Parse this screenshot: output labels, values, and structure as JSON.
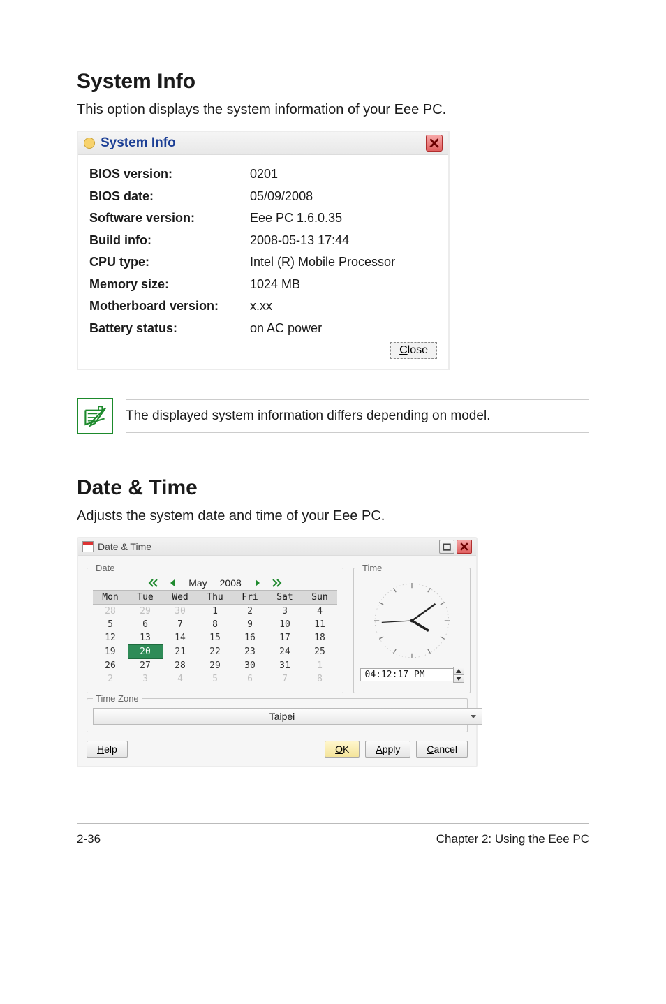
{
  "section1": {
    "title": "System Info",
    "description": "This option displays the system information of your Eee PC."
  },
  "sysinfo_window": {
    "title": "System Info",
    "rows": [
      {
        "label": "BIOS version:",
        "value": "0201"
      },
      {
        "label": "BIOS date:",
        "value": "05/09/2008"
      },
      {
        "label": "Software version:",
        "value": "Eee PC 1.6.0.35"
      },
      {
        "label": "Build info:",
        "value": "2008-05-13 17:44"
      },
      {
        "label": "CPU type:",
        "value": "Intel (R) Mobile Processor"
      },
      {
        "label": "Memory size:",
        "value": "1024 MB"
      },
      {
        "label": "Motherboard version:",
        "value": "x.xx"
      },
      {
        "label": "Battery status:",
        "value": "on AC power"
      }
    ],
    "close_label": "Close"
  },
  "note": {
    "text": "The displayed system information differs depending on model."
  },
  "section2": {
    "title": "Date & Time",
    "description": "Adjusts the system date and time of your Eee PC."
  },
  "datetime_window": {
    "title": "Date & Time",
    "date_legend": "Date",
    "time_legend": "Time",
    "timezone_legend": "Time Zone",
    "month": "May",
    "year": "2008",
    "day_headers": [
      "Mon",
      "Tue",
      "Wed",
      "Thu",
      "Fri",
      "Sat",
      "Sun"
    ],
    "weeks": [
      [
        {
          "d": "28",
          "dim": true
        },
        {
          "d": "29",
          "dim": true
        },
        {
          "d": "30",
          "dim": true
        },
        {
          "d": "1"
        },
        {
          "d": "2"
        },
        {
          "d": "3"
        },
        {
          "d": "4"
        }
      ],
      [
        {
          "d": "5"
        },
        {
          "d": "6"
        },
        {
          "d": "7"
        },
        {
          "d": "8"
        },
        {
          "d": "9"
        },
        {
          "d": "10"
        },
        {
          "d": "11"
        }
      ],
      [
        {
          "d": "12"
        },
        {
          "d": "13"
        },
        {
          "d": "14"
        },
        {
          "d": "15"
        },
        {
          "d": "16"
        },
        {
          "d": "17"
        },
        {
          "d": "18"
        }
      ],
      [
        {
          "d": "19"
        },
        {
          "d": "20",
          "today": true
        },
        {
          "d": "21"
        },
        {
          "d": "22"
        },
        {
          "d": "23"
        },
        {
          "d": "24"
        },
        {
          "d": "25"
        }
      ],
      [
        {
          "d": "26"
        },
        {
          "d": "27"
        },
        {
          "d": "28"
        },
        {
          "d": "29"
        },
        {
          "d": "30"
        },
        {
          "d": "31"
        },
        {
          "d": "1",
          "dim": true
        }
      ],
      [
        {
          "d": "2",
          "dim": true
        },
        {
          "d": "3",
          "dim": true
        },
        {
          "d": "4",
          "dim": true
        },
        {
          "d": "5",
          "dim": true
        },
        {
          "d": "6",
          "dim": true
        },
        {
          "d": "7",
          "dim": true
        },
        {
          "d": "8",
          "dim": true
        }
      ]
    ],
    "time_value": "04:12:17 PM",
    "timezone_value": "Taipei",
    "buttons": {
      "help": "Help",
      "ok": "OK",
      "apply": "Apply",
      "cancel": "Cancel"
    }
  },
  "footer": {
    "left": "2-36",
    "right": "Chapter 2: Using the Eee PC"
  }
}
